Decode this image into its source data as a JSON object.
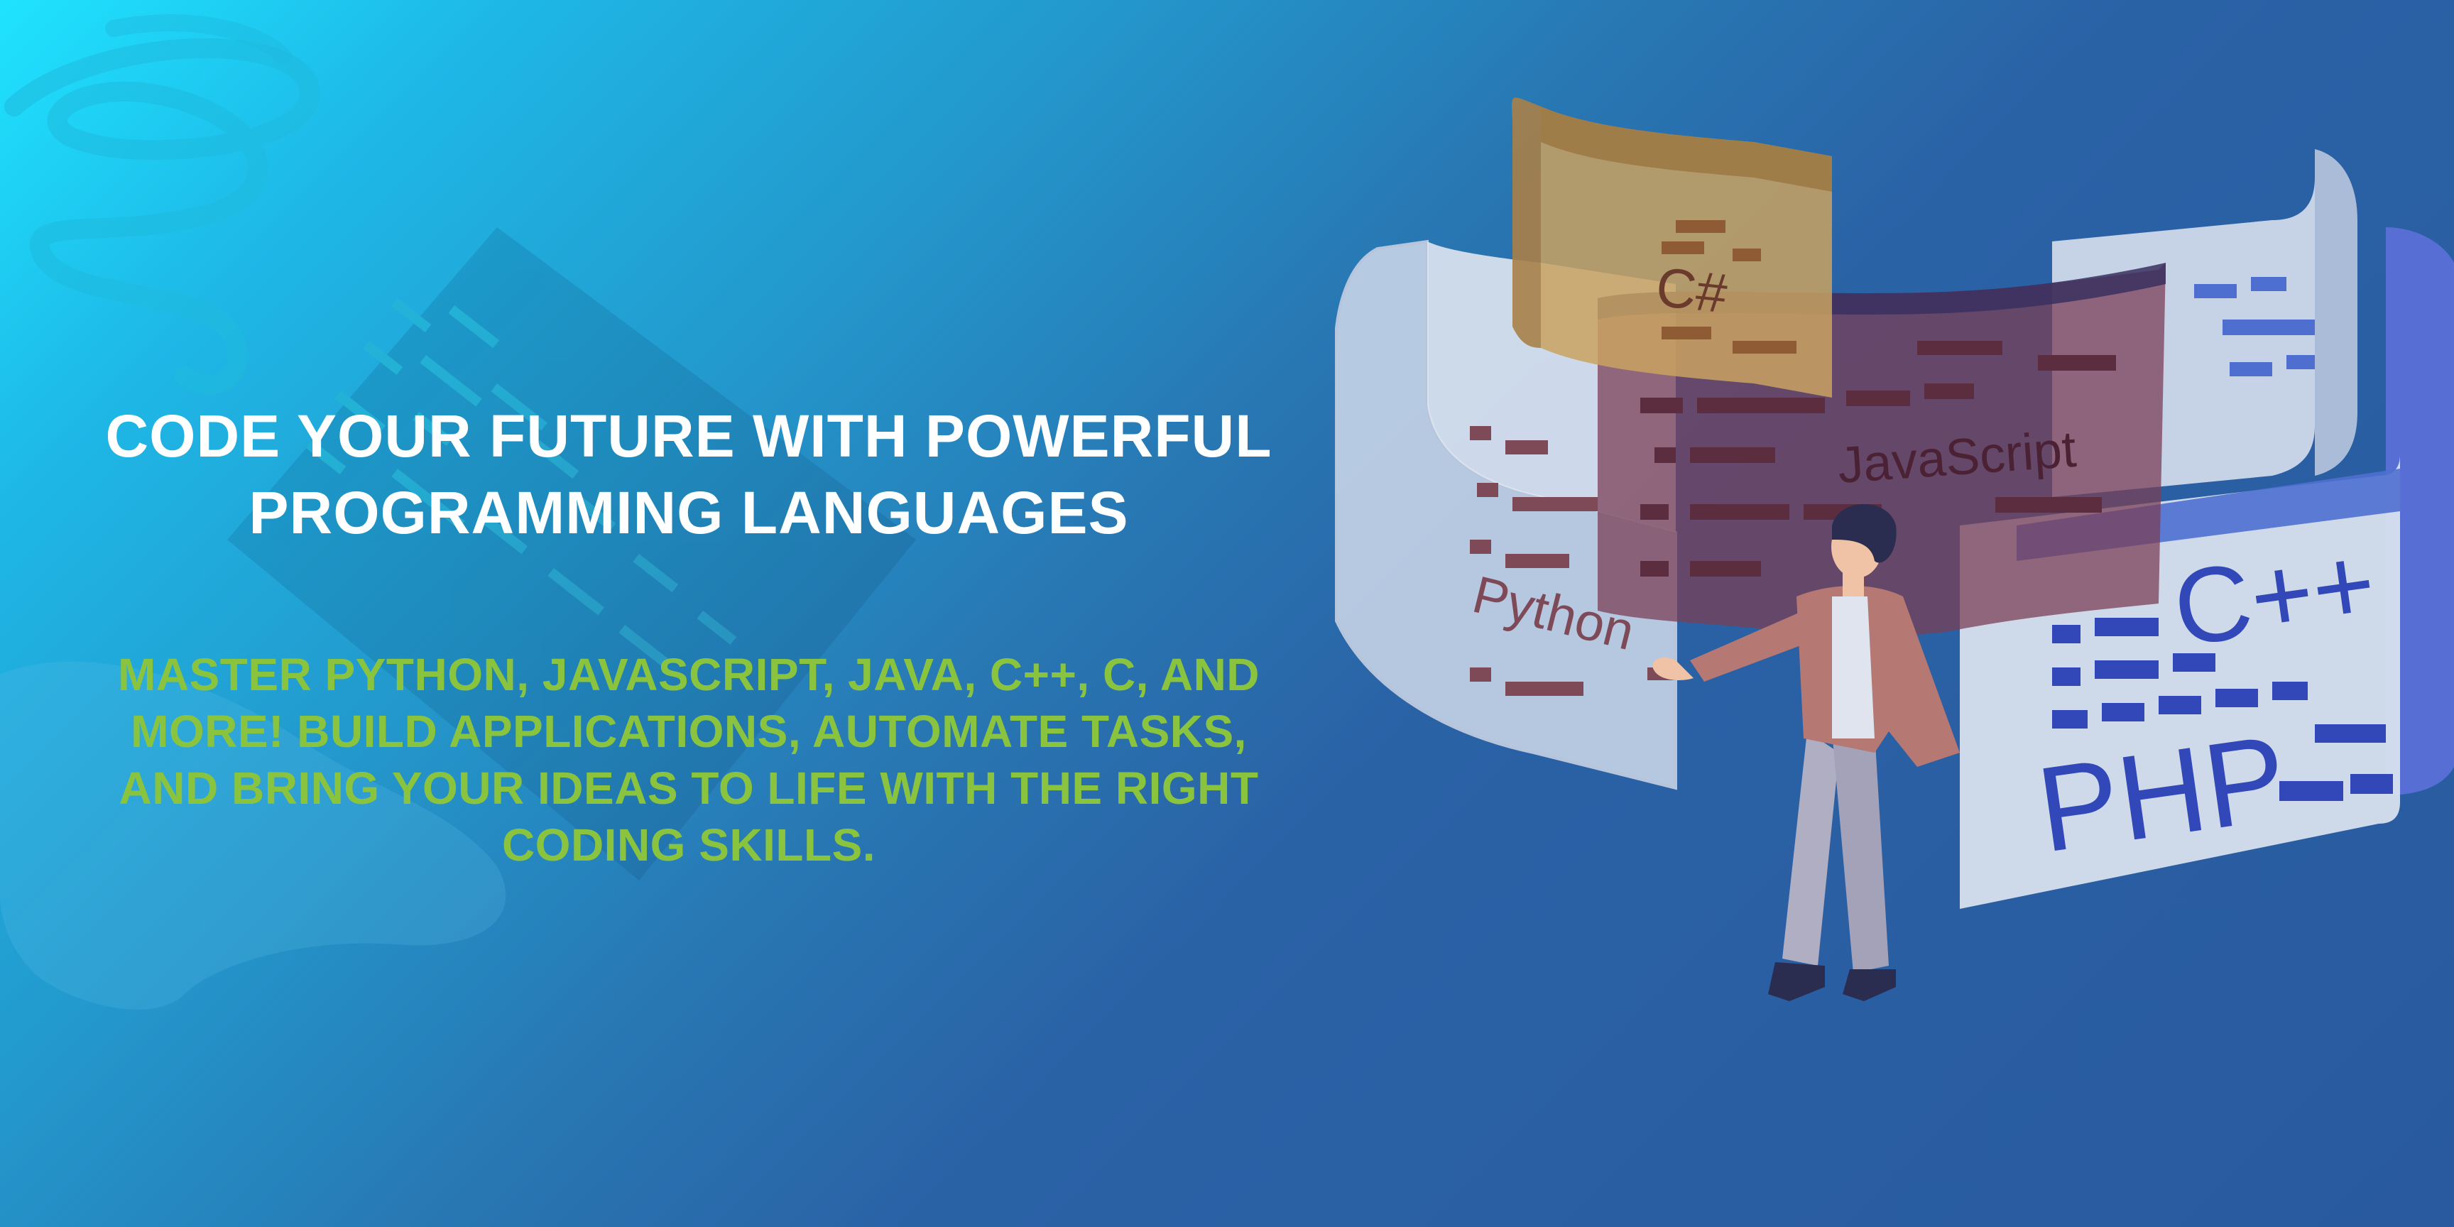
{
  "hero": {
    "headline": "CODE YOUR FUTURE WITH POWERFUL PROGRAMMING LANGUAGES",
    "subheadline": "MASTER PYTHON, JAVASCRIPT, JAVA, C++, C, AND MORE! BUILD APPLICATIONS, AUTOMATE TASKS, AND BRING YOUR IDEAS TO LIFE WITH THE RIGHT CODING SKILLS."
  },
  "illustration": {
    "panels": {
      "csharp": "C#",
      "javascript": "JavaScript",
      "python": "Python",
      "cpp": "C++",
      "php": "PHP"
    }
  },
  "colors": {
    "headline": "#ffffff",
    "subheadline": "#8ac43f",
    "background_start": "#1fe3ff",
    "background_end": "#295a9f"
  }
}
